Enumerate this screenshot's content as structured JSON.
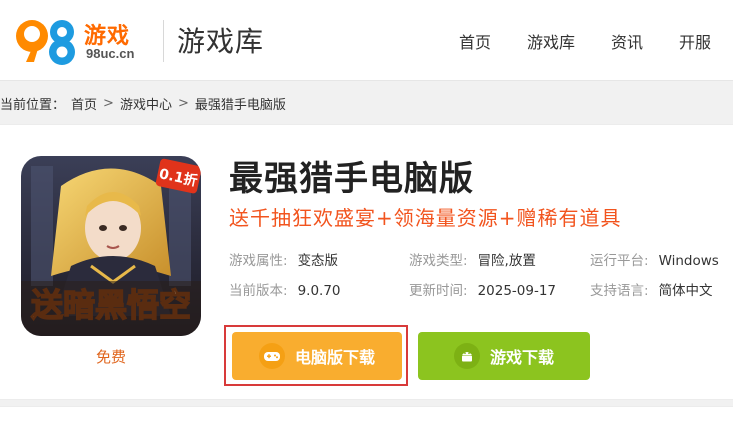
{
  "header": {
    "logo_digits": "98",
    "logo_brand": "游戏",
    "logo_domain": "98uc.cn",
    "section_title": "游戏库",
    "nav": [
      "首页",
      "游戏库",
      "资讯",
      "开服"
    ]
  },
  "breadcrumb": {
    "prefix": "当前位置：",
    "items": [
      "首页",
      "游戏中心",
      "最强猎手电脑版"
    ],
    "separator": ">"
  },
  "game": {
    "title": "最强猎手电脑版",
    "subtitle": "送千抽狂欢盛宴+领海量资源+赠稀有道具",
    "cover_badge": "0.1折",
    "cover_caption": "送暗黑悟空",
    "price": "免费",
    "meta": [
      [
        {
          "label": "游戏属性:",
          "value": "变态版"
        },
        {
          "label": "游戏类型:",
          "value": "冒险,放置"
        },
        {
          "label": "运行平台:",
          "value": "Windows"
        }
      ],
      [
        {
          "label": "当前版本:",
          "value": "9.0.70"
        },
        {
          "label": "更新时间:",
          "value": "2025-09-17"
        },
        {
          "label": "支持语言:",
          "value": "简体中文"
        }
      ]
    ],
    "buttons": {
      "pc_label": "电脑版下载",
      "mobile_label": "游戏下载"
    }
  },
  "colors": {
    "accent_orange": "#f9ad2f",
    "accent_green": "#8cc41f",
    "subtitle_red": "#f2541e",
    "highlight_red": "#d83a3a"
  }
}
